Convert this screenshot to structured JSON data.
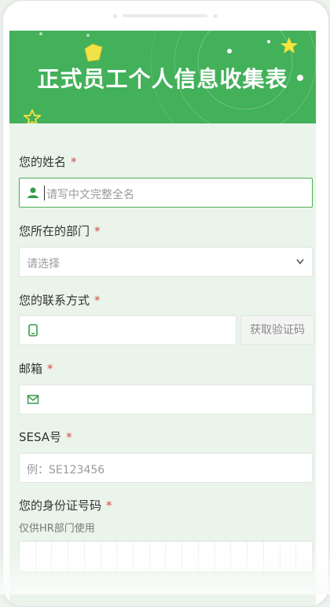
{
  "banner": {
    "title": "正式员工个人信息收集表"
  },
  "fields": {
    "name": {
      "label": "您的姓名",
      "required": "*",
      "placeholder": "请写中文完整全名",
      "icon": "user-icon"
    },
    "department": {
      "label": "您所在的部门",
      "required": "*",
      "value": "请选择",
      "icon": "chevron-down-icon"
    },
    "contact": {
      "label": "您的联系方式",
      "required": "*",
      "button": "获取验证码",
      "icon": "phone-icon"
    },
    "email": {
      "label": "邮箱",
      "required": "*",
      "icon": "mail-icon"
    },
    "sesa": {
      "label": "SESA号",
      "required": "*",
      "placeholder": "例：SE123456"
    },
    "idcard": {
      "label": "您的身份证号码",
      "required": "*",
      "note": "仅供HR部门使用",
      "boxes": 18
    }
  },
  "colors": {
    "banner": "#43b05a",
    "accent": "#4caf50",
    "required": "#e04646",
    "background": "#eaf4ea"
  }
}
